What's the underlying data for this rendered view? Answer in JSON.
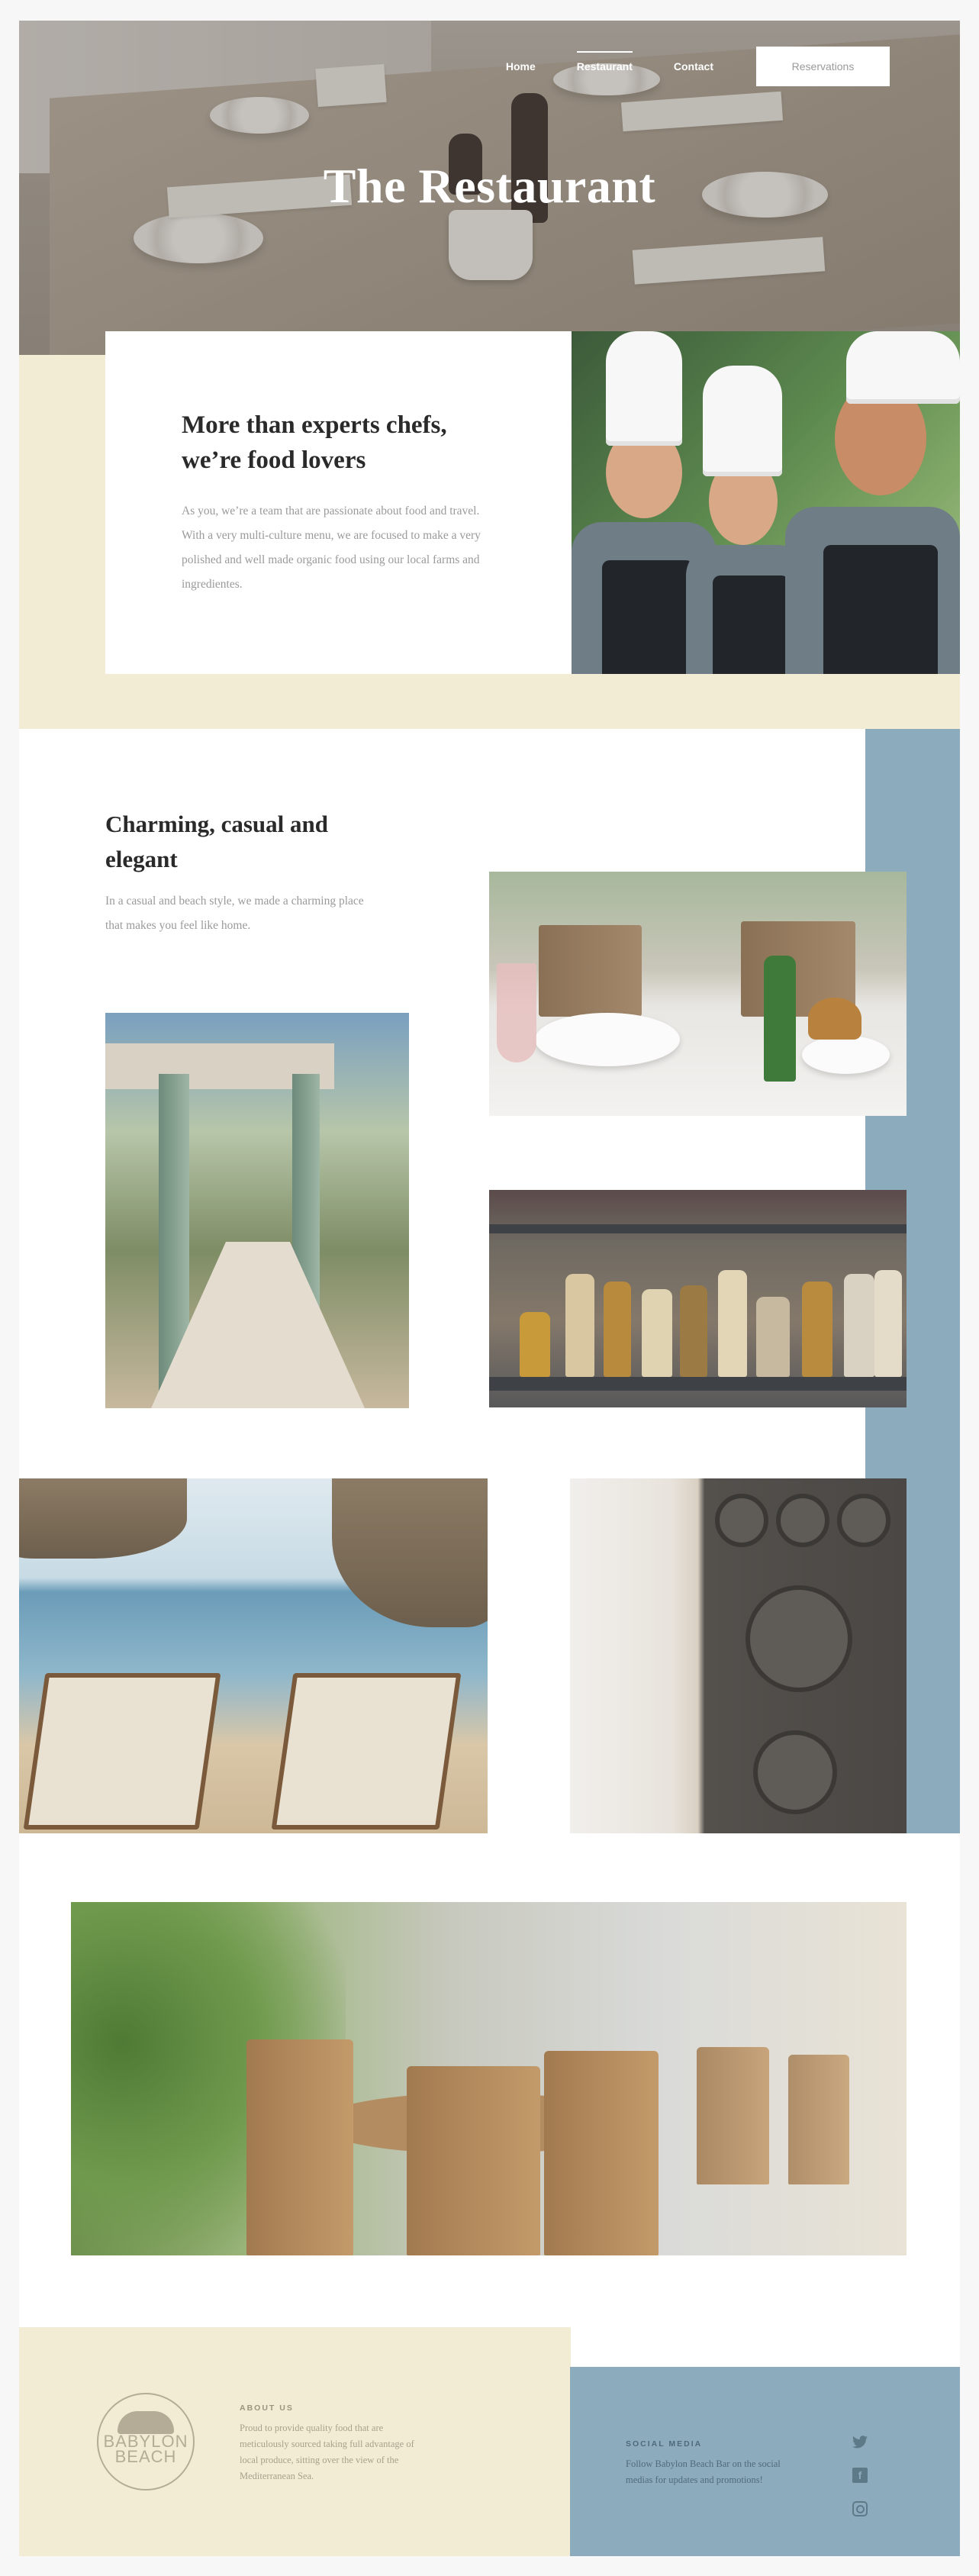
{
  "nav": {
    "items": [
      "Home",
      "Restaurant",
      "Contact"
    ],
    "active": "Restaurant",
    "reservations_label": "Reservations"
  },
  "hero": {
    "title": "The Restaurant"
  },
  "intro": {
    "heading": "More than experts chefs, we’re food lovers",
    "body": "As you, we’re a team that are passionate about food and travel. With a very multi-culture menu, we are focused to make a very polished and well made organic food using our local farms and ingredientes."
  },
  "section2": {
    "heading": "Charming, casual and elegant",
    "body": "In a casual and beach style, we made a charming place that makes you feel like home."
  },
  "footer": {
    "logo_text": "BABYLON BEACH",
    "about_heading": "ABOUT US",
    "about_text": "Proud to provide quality food that are meticulously sourced taking full advantage of local produce, sitting over the view of the Mediterranean Sea.",
    "social_heading": "SOCIAL MEDIA",
    "social_text": "Follow Babylon Beach Bar on the social medias for updates and promotions!",
    "social_icons": [
      "twitter-icon",
      "facebook-icon",
      "instagram-icon"
    ]
  },
  "colors": {
    "cream": "#f3ecd5",
    "blue": "#8cabbc",
    "text_dark": "#2a2a2a",
    "text_muted": "#9a9a9a"
  }
}
